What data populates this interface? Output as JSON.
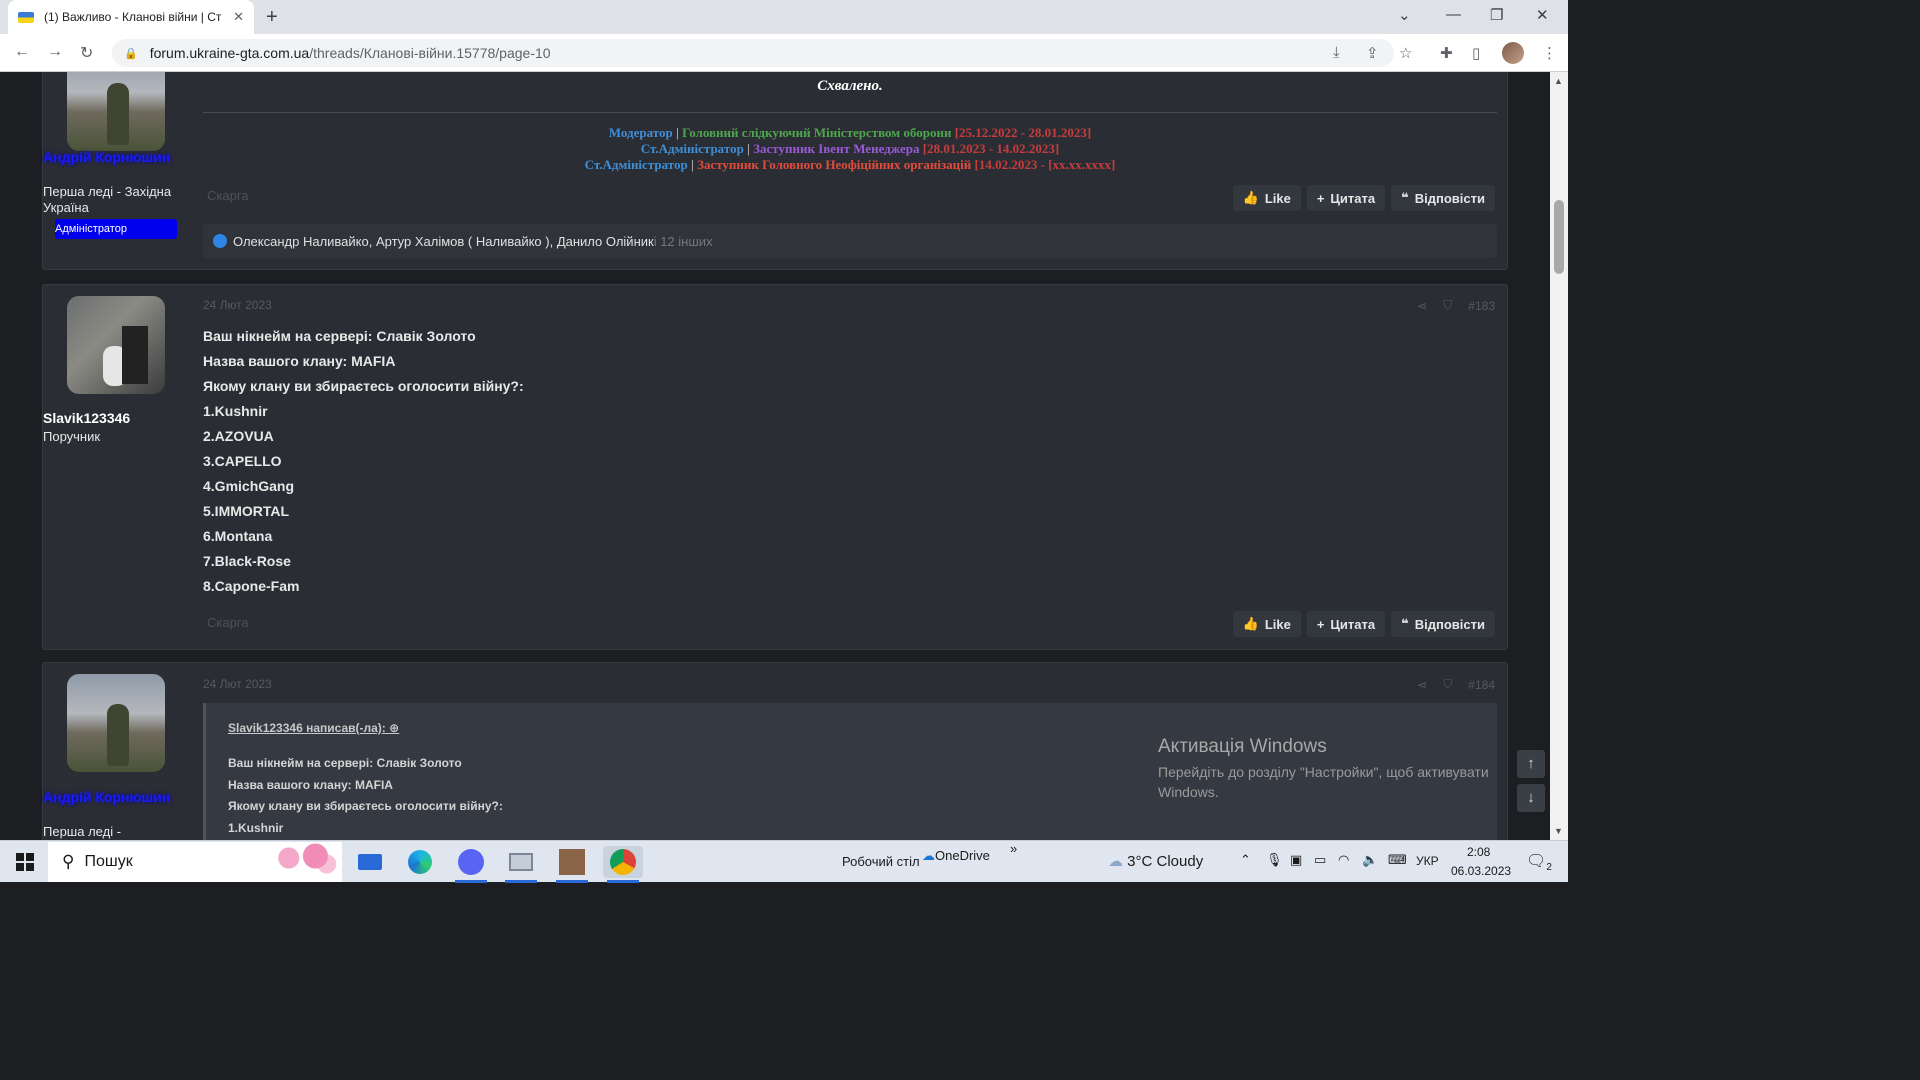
{
  "browser": {
    "tab_title": "(1) Важливо - Кланові війни | Ст",
    "url_domain": "forum.ukraine-gta.com.ua",
    "url_path": "/threads/Кланові-війни.15778/page-10"
  },
  "post1": {
    "author": "Андрій Корнюшин",
    "user_title": "Перша леді - Західна Україна",
    "badge": "Адміністратор",
    "approved": "Схвалено.",
    "sig": [
      {
        "a": "Модератор",
        "sep": " | ",
        "b": "Головний слідкуючий Міністерством оборони",
        "c": " [25.12.2022 - 28.01.2023]"
      },
      {
        "a": "Ст.Адміністратор",
        "sep": " | ",
        "b": "Заступник Івент Менеджера",
        "c": " [28.01.2023 - 14.02.2023]"
      },
      {
        "a": "Ст.Адміністратор",
        "sep": " | ",
        "b": "Заступник Головного Неофіційних організацій",
        "c": " [14.02.2023 - [xx.xx.xxxx]"
      }
    ],
    "report": "Скарга",
    "likes_names": "Олександр Наливайко, Артур Халімов ( Наливайко ), Данило Олійник",
    "likes_others": " і 12 інших"
  },
  "post2": {
    "author": "Slavik123346",
    "user_title": "Поручник",
    "date": "24 Лют 2023",
    "number": "#183",
    "lines": [
      "Ваш нікнейм на сервері: Славік Золото",
      "Назва вашого клану: MAFIA",
      "Якому клану ви збираєтесь оголосити війну?:",
      "1.Kushnir",
      "2.AZOVUA",
      "3.CAPELLO",
      "4.GmichGang",
      "5.IMMORTAL",
      "6.Montana",
      "7.Black-Rose",
      "8.Capone-Fam"
    ],
    "report": "Скарга"
  },
  "post3": {
    "author": "Андрій Корнюшин",
    "user_title": "Перша леді -",
    "date": "24 Лют 2023",
    "number": "#184",
    "quote_head": "Slavik123346 написав(-ла):",
    "quote_lines": [
      "Ваш нікнейм на сервері: Славік Золото",
      "Назва вашого клану: MAFIA",
      "Якому клану ви збираєтесь оголосити війну?:",
      "1.Kushnir"
    ]
  },
  "actions": {
    "like": "Like",
    "quote": "Цитата",
    "reply": "Відповісти"
  },
  "activation": {
    "title": "Активація Windows",
    "text": "Перейдіть до розділу \"Настройки\", щоб активувати Windows."
  },
  "taskbar": {
    "search": "Пошук",
    "desktop": "Робочий стіл",
    "onedrive": "OneDrive",
    "weather": "3°C  Cloudy",
    "lang": "УКР",
    "time": "2:08",
    "date": "06.03.2023",
    "notif_count": "2"
  },
  "colors": {
    "accent": "#2a6ad8",
    "name_blue": "#1a1aff",
    "post_bg": "#2a2d33"
  }
}
